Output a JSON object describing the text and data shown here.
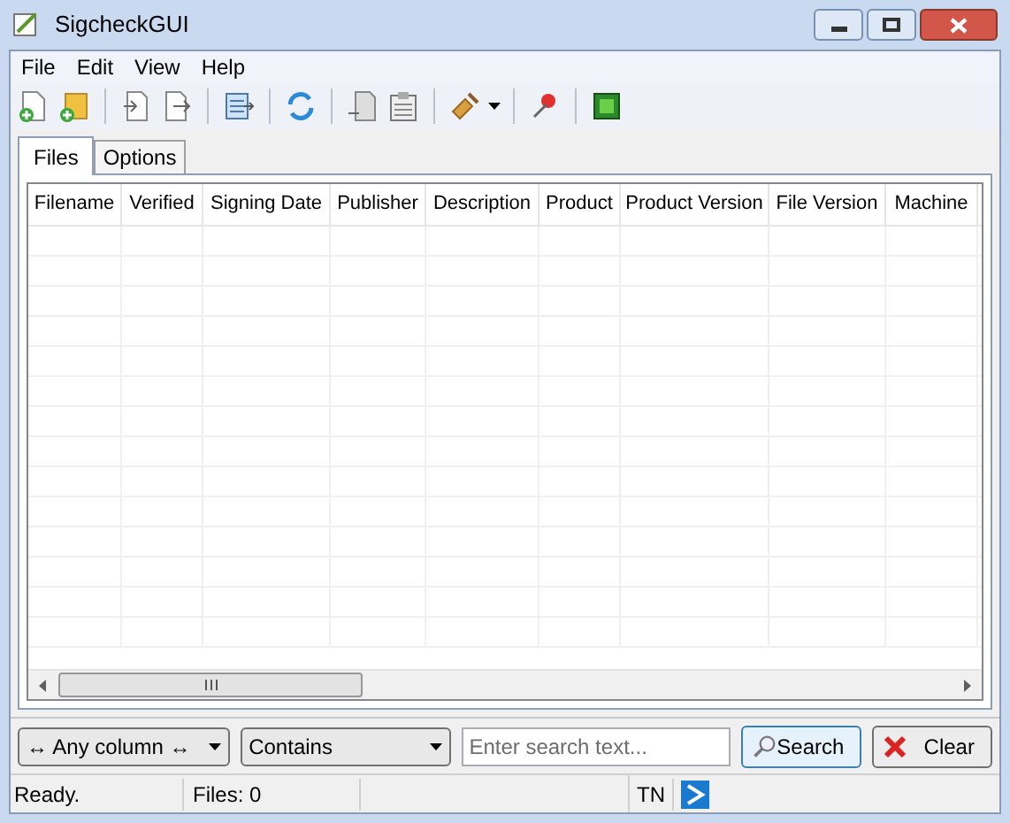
{
  "window": {
    "title": "SigcheckGUI"
  },
  "menu": [
    "File",
    "Edit",
    "View",
    "Help"
  ],
  "tabs": [
    {
      "label": "Files",
      "selected": true
    },
    {
      "label": "Options",
      "selected": false
    }
  ],
  "table": {
    "columns": [
      "Filename",
      "Verified",
      "Signing Date",
      "Publisher",
      "Description",
      "Product",
      "Product Version",
      "File Version",
      "Machine"
    ]
  },
  "search": {
    "column_filter": "↔ Any column ↔",
    "match_mode": "Contains",
    "placeholder": "Enter search text...",
    "buttons": [
      {
        "kind": "search",
        "label": "Search"
      },
      {
        "kind": "clear",
        "label": "Clear"
      }
    ]
  },
  "status_bar": {
    "status": "Ready.",
    "files": "Files: 0",
    "indicator": "TN"
  }
}
